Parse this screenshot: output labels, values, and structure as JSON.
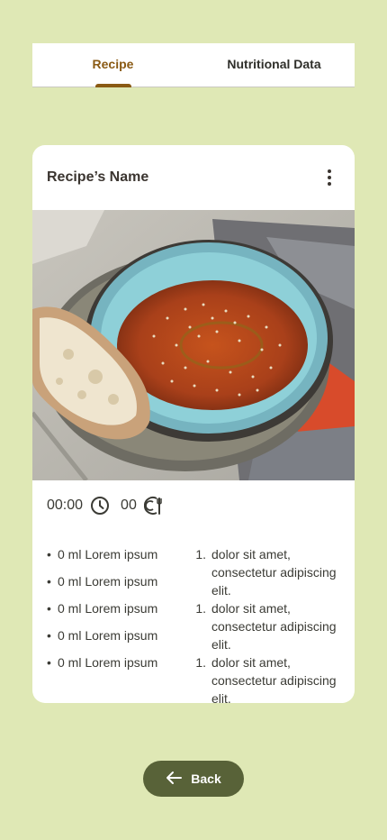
{
  "tabs": [
    {
      "label": "Recipe",
      "active": true
    },
    {
      "label": "Nutritional Data",
      "active": false
    }
  ],
  "card": {
    "title": "Recipe’s Name",
    "image_alt": "bowl of tomato soup with sesame seeds and bread",
    "time": "00:00",
    "servings": "00",
    "time_icon": "clock-icon",
    "servings_icon": "plate-utensils-icon",
    "ingredients": [
      "0 ml Lorem ipsum",
      "0 ml Lorem ipsum",
      "0 ml Lorem ipsum",
      "0 ml Lorem ipsum",
      "0 ml Lorem ipsum"
    ],
    "steps": [
      {
        "num": "1.",
        "text": "dolor sit amet, consectetur adipiscing elit."
      },
      {
        "num": "1.",
        "text": "dolor sit amet, consectetur adipiscing elit."
      },
      {
        "num": "1.",
        "text": "dolor sit amet, consectetur adipiscing elit."
      }
    ]
  },
  "back_button": {
    "label": "Back",
    "icon": "arrow-left-icon"
  },
  "colors": {
    "background": "#dfe8b5",
    "accent": "#8a5a14",
    "button": "#586238"
  }
}
